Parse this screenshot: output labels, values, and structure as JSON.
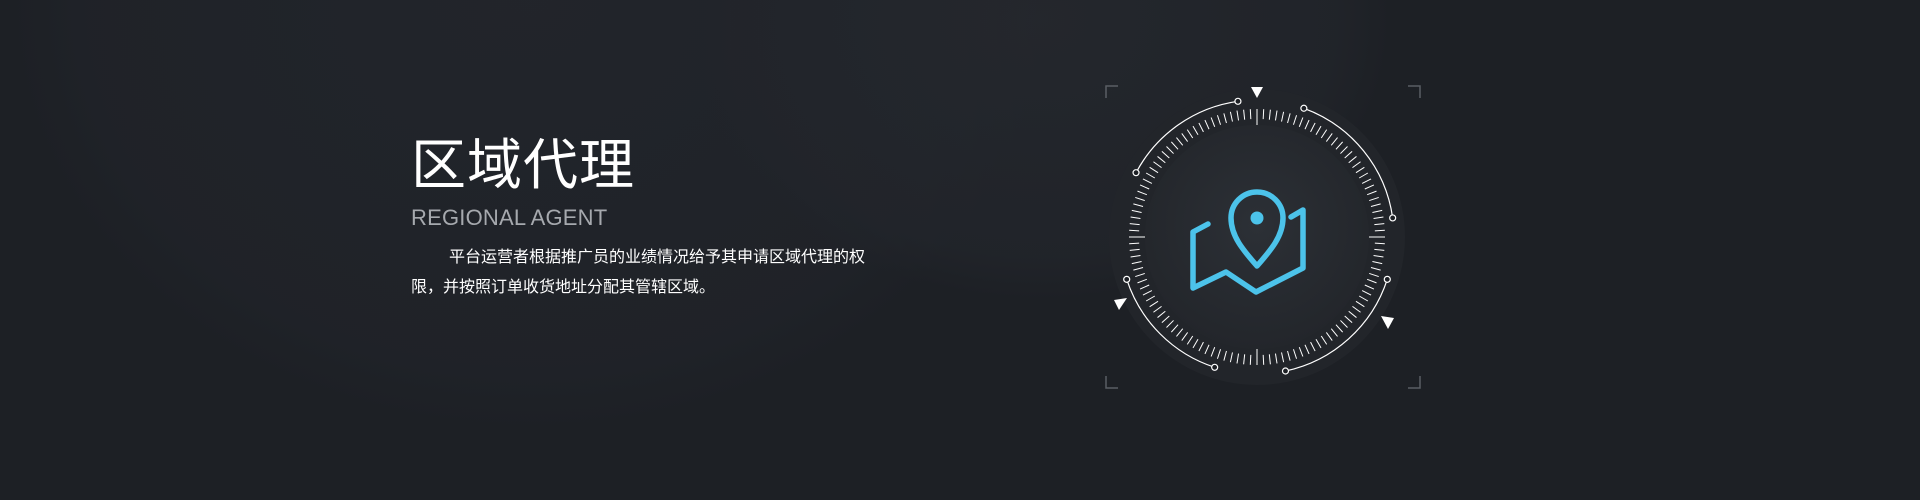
{
  "section": {
    "title": "区域代理",
    "subtitle": "REGIONAL AGENT",
    "description": "平台运营者根据推广员的业绩情况给予其申请区域代理的权限，并按照订单收货地址分配其管辖区域。"
  },
  "icon": {
    "name": "map-pin-icon",
    "accent_color": "#4cc3ea",
    "ring_color": "#ffffff",
    "background_color": "#1d2025"
  }
}
